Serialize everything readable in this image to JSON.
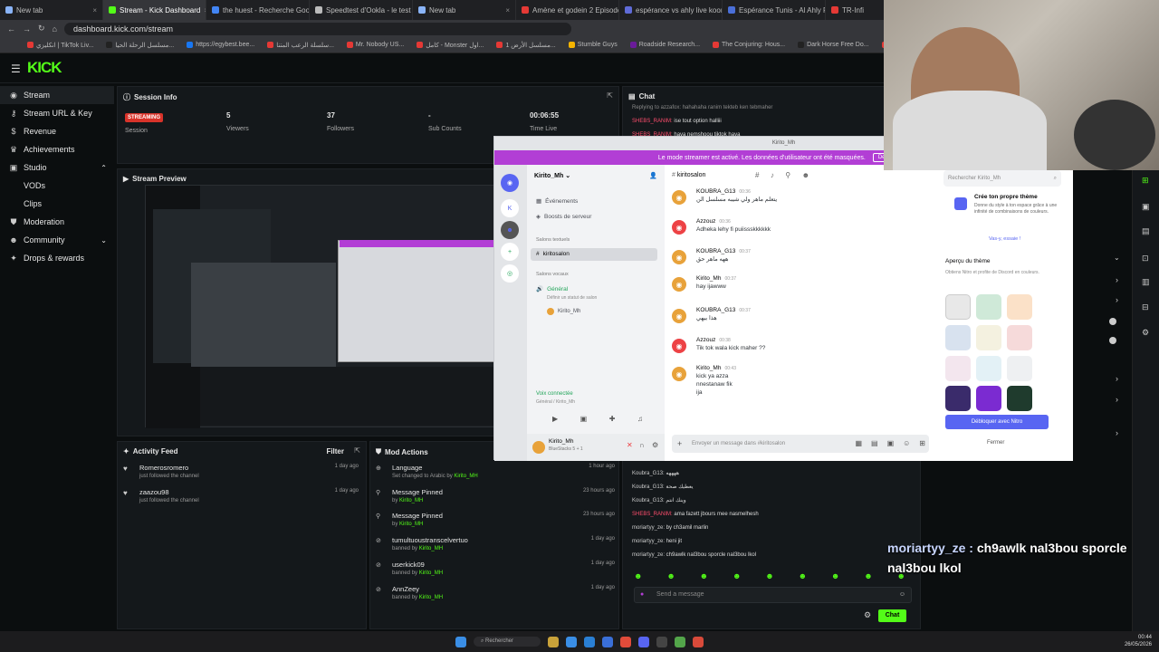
{
  "browser": {
    "tabs": [
      {
        "label": "New tab",
        "color": "#8ab4f8",
        "active": false
      },
      {
        "label": "Stream - Kick Dashboard",
        "color": "#53fc18",
        "active": true
      },
      {
        "label": "the huest - Recherche Google",
        "color": "#4285f4",
        "active": false
      },
      {
        "label": "Speedtest d'Ookla - le test de",
        "color": "#bbbbbb",
        "active": false
      },
      {
        "label": "New tab",
        "color": "#8ab4f8",
        "active": false
      },
      {
        "label": "Amène et godein 2 Episode",
        "color": "#e53935",
        "active": false
      },
      {
        "label": "espérance vs ahly live koora",
        "color": "#5f6bd8",
        "active": false
      },
      {
        "label": "Espérance Tunis - Al Ahly FC",
        "color": "#4a6fd8",
        "active": false
      },
      {
        "label": "TR-Infi",
        "color": "#e53935",
        "active": false
      }
    ],
    "url": "dashboard.kick.com/stream",
    "bookmarks": [
      {
        "label": "انكليزي | TikTok Liv...",
        "color": "#e53935"
      },
      {
        "label": "مسلسل الرحلة الحيا...",
        "color": "#222222"
      },
      {
        "label": "https://egybest.bee...",
        "color": "#1877f2"
      },
      {
        "label": "سلسلة الرعب المتنا...",
        "color": "#e53935"
      },
      {
        "label": "Mr. Nobody US...",
        "color": "#e53935"
      },
      {
        "label": "كامل - Monster اول...",
        "color": "#e53935"
      },
      {
        "label": "مسلسل الأرض 1...",
        "color": "#e53935"
      },
      {
        "label": "Stumble Guys",
        "color": "#f5b400"
      },
      {
        "label": "Roadside Research...",
        "color": "#6a1b9a"
      },
      {
        "label": "The Conjuring: Hous...",
        "color": "#e53935"
      },
      {
        "label": "Dark Horse Free Do...",
        "color": "#222222"
      },
      {
        "label": "Recover Rep",
        "color": "#e53935"
      }
    ]
  },
  "sidebar": {
    "items": [
      {
        "label": "Stream",
        "icon": "broadcast-icon",
        "active": true,
        "sub": false
      },
      {
        "label": "Stream URL & Key",
        "icon": "key-icon",
        "active": false,
        "sub": false
      },
      {
        "label": "Revenue",
        "icon": "dollar-icon",
        "active": false,
        "sub": false
      },
      {
        "label": "Achievements",
        "icon": "trophy-icon",
        "active": false,
        "sub": false
      },
      {
        "label": "Studio",
        "icon": "studio-icon",
        "active": false,
        "sub": false,
        "chevron": "up"
      },
      {
        "label": "VODs",
        "icon": "",
        "active": false,
        "sub": true
      },
      {
        "label": "Clips",
        "icon": "",
        "active": false,
        "sub": true
      },
      {
        "label": "Moderation",
        "icon": "shield-icon",
        "active": false,
        "sub": false
      },
      {
        "label": "Community",
        "icon": "users-icon",
        "active": false,
        "sub": false,
        "chevron": "down"
      },
      {
        "label": "Drops & rewards",
        "icon": "gift-icon",
        "active": false,
        "sub": false
      }
    ]
  },
  "session": {
    "title": "Session Info",
    "badge": "STREAMING",
    "status_label": "Session",
    "viewers": "5",
    "viewers_label": "Viewers",
    "followers": "37",
    "followers_label": "Followers",
    "subs": "-",
    "subs_label": "Sub Counts",
    "time": "00:06:55",
    "time_label": "Time Live"
  },
  "preview": {
    "title": "Stream Preview"
  },
  "activity": {
    "title": "Activity Feed",
    "filter": "Filter",
    "items": [
      {
        "name": "Romerosromero",
        "sub": "just followed the channel",
        "time": "1 day ago"
      },
      {
        "name": "zaazou98",
        "sub": "just followed the channel",
        "time": "1 day ago"
      }
    ]
  },
  "mod": {
    "title": "Mod Actions",
    "items": [
      {
        "name": "Language",
        "sub": "Set changed to ",
        "tail": "Arabic by ",
        "by": "Kirito_MH",
        "time": "1 hour ago",
        "icon": "globe-icon"
      },
      {
        "name": "Message Pinned",
        "sub": "by ",
        "tail": "",
        "by": "Kirito_MH",
        "time": "23 hours ago",
        "icon": "pin-icon"
      },
      {
        "name": "Message Pinned",
        "sub": "by ",
        "tail": "",
        "by": "Kirito_MH",
        "time": "23 hours ago",
        "icon": "pin-icon"
      },
      {
        "name": "tumultuoustranscelvertuo",
        "sub": "banned by ",
        "tail": "",
        "by": "Kirito_MH",
        "time": "1 day ago",
        "icon": "ban-icon"
      },
      {
        "name": "userkick09",
        "sub": "banned by ",
        "tail": "",
        "by": "Kirito_MH",
        "time": "1 day ago",
        "icon": "ban-icon"
      },
      {
        "name": "AnnZeey",
        "sub": "banned by ",
        "tail": "",
        "by": "Kirito_MH",
        "time": "1 day ago",
        "icon": "ban-icon"
      }
    ]
  },
  "chat": {
    "title": "Chat",
    "top_lines": [
      {
        "user": "Replying to azzafox: hahahaha ranim tekteb ken tebmaher",
        "text": "",
        "color": "#8a8a8a"
      },
      {
        "user": "SHEBS_RANIM:",
        "text": " ise tout option halliii",
        "color": "#ff4d6d"
      },
      {
        "user": "SHEBS_RANIM:",
        "text": " haya nemshoou tiktok haya",
        "color": "#ff4d6d"
      }
    ],
    "bottom_lines": [
      {
        "user": "Koubra_G13:",
        "text": " ههههه",
        "color": "#cccccc"
      },
      {
        "user": "Koubra_G13:",
        "text": " يعطيك صحة",
        "color": "#cccccc"
      },
      {
        "user": "Koubra_G13:",
        "text": " وينك انتم",
        "color": "#cccccc"
      },
      {
        "user": "SHEBS_RANIM:",
        "text": " ama fazett jbours mee nasmelhesh",
        "color": "#ff4d6d"
      },
      {
        "user": "moriartyy_ze:",
        "text": " by ch3amil marlin",
        "color": "#cccccc"
      },
      {
        "user": "moriartyy_ze:",
        "text": " heni jit",
        "color": "#cccccc"
      },
      {
        "user": "moriartyy_ze:",
        "text": " ch9awlk nal3bou sporcle nal3bou lkol",
        "color": "#cccccc"
      }
    ],
    "placeholder": "Send a message",
    "send": "Chat"
  },
  "discord": {
    "window_title": "Kirito_Mh",
    "banner": "Le mode streamer est activé. Les données d'utilisateur ont été masquées.",
    "banner_btn": "Désactiver",
    "server": "Kirito_Mh",
    "channel_header": "kiritosalon",
    "search": "Rechercher Kirito_Mh",
    "events": "Événements",
    "boosts": "Boosts de serveur",
    "text_channels": "Salons textuels",
    "text_channel": "kiritosalon",
    "voice_channels": "Salons vocaux",
    "voice_channel": "Général",
    "voice_sub": "Définir un statut de salon",
    "voice_user": "Kirito_Mh",
    "voice_connected": "Voix connectée",
    "voice_connected_sub": "Général / Kirito_Mh",
    "self_name": "Kirito_Mh",
    "self_status": "BlueStacks 5 + 1",
    "input_placeholder": "Envoyer un message dans #kiritosalon",
    "messages": [
      {
        "name": "KOUBRA_G13",
        "body": "يتعلم ماهر ولي شيبه مسلسل الن",
        "red": false,
        "time": "00:36"
      },
      {
        "name": "Azzouz",
        "body": "Adheka lehy fi puiissskkkkkk",
        "red": true,
        "time": "00:36"
      },
      {
        "name": "KOUBRA_G13",
        "body": "ههه ماهر حق",
        "red": false,
        "time": "00:37"
      },
      {
        "name": "Kirito_Mh",
        "body": "hay ijawww",
        "red": false,
        "time": "00:37"
      },
      {
        "name": "KOUBRA_G13",
        "body": "هذا بيهي",
        "red": false,
        "time": "00:37"
      },
      {
        "name": "Azzouz",
        "body": "Tik tok wala kick maher ??",
        "red": true,
        "time": "00:38"
      },
      {
        "name": "Kirito_Mh",
        "body": "kick ya azza\nnnestanaw fik\nija",
        "red": false,
        "time": "00:43"
      }
    ],
    "theme_title": "Crée ton propre thème",
    "theme_desc": "Donne du style à ton espace grâce à une infinité de combinaisons de couleurs.",
    "theme_try": "Vas-y, essaie !",
    "preview_title": "Aperçu du thème",
    "preview_desc": "Obtiens Nitro et profite de Discord en couleurs.",
    "unlock": "Débloquer avec Nitro",
    "close": "Fermer"
  },
  "overlay": {
    "user": "moriartyy_ze :",
    "text": " ch9awlk nal3bou sporcle nal3bou lkol"
  },
  "taskbar": {
    "search": "Rechercher",
    "time": "00:44",
    "date": "26/05/2026"
  }
}
